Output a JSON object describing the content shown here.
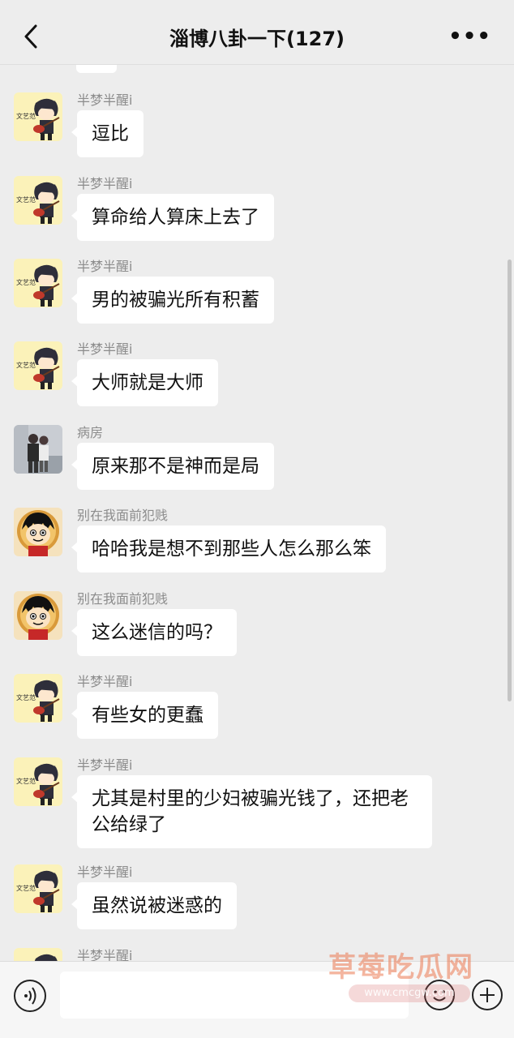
{
  "header": {
    "title": "淄博八卦一下(127)",
    "back_icon": "chevron-left-icon",
    "more_label": "•••"
  },
  "messages": [
    {
      "sender": "半梦半醒i",
      "text": "逗比",
      "avatar": "guitar-boy"
    },
    {
      "sender": "半梦半醒i",
      "text": "算命给人算床上去了",
      "avatar": "guitar-boy"
    },
    {
      "sender": "半梦半醒i",
      "text": "男的被骗光所有积蓄",
      "avatar": "guitar-boy"
    },
    {
      "sender": "半梦半醒i",
      "text": "大师就是大师",
      "avatar": "guitar-boy"
    },
    {
      "sender": "病房",
      "text": "原来那不是神而是局",
      "avatar": "couple-photo"
    },
    {
      "sender": "别在我面前犯贱",
      "text": "哈哈我是想不到那些人怎么那么笨",
      "avatar": "luffy"
    },
    {
      "sender": "别在我面前犯贱",
      "text": "这么迷信的吗？",
      "avatar": "luffy"
    },
    {
      "sender": "半梦半醒i",
      "text": "有些女的更蠢",
      "avatar": "guitar-boy"
    },
    {
      "sender": "半梦半醒i",
      "text": "尤其是村里的少妇被骗光钱了，还把老公给绿了",
      "avatar": "guitar-boy"
    },
    {
      "sender": "半梦半醒i",
      "text": "虽然说被迷惑的",
      "avatar": "guitar-boy"
    },
    {
      "sender": "半梦半醒i",
      "text": "",
      "avatar": "guitar-boy"
    }
  ],
  "bottom_bar": {
    "voice_icon": "voice-icon",
    "emoji_icon": "emoji-icon",
    "plus_icon": "plus-icon"
  },
  "watermark": {
    "text": "草莓吃瓜网",
    "url": "www.cmcgw.com"
  },
  "colors": {
    "background": "#ededed",
    "bubble": "#ffffff",
    "sender": "#8c8c8c"
  }
}
